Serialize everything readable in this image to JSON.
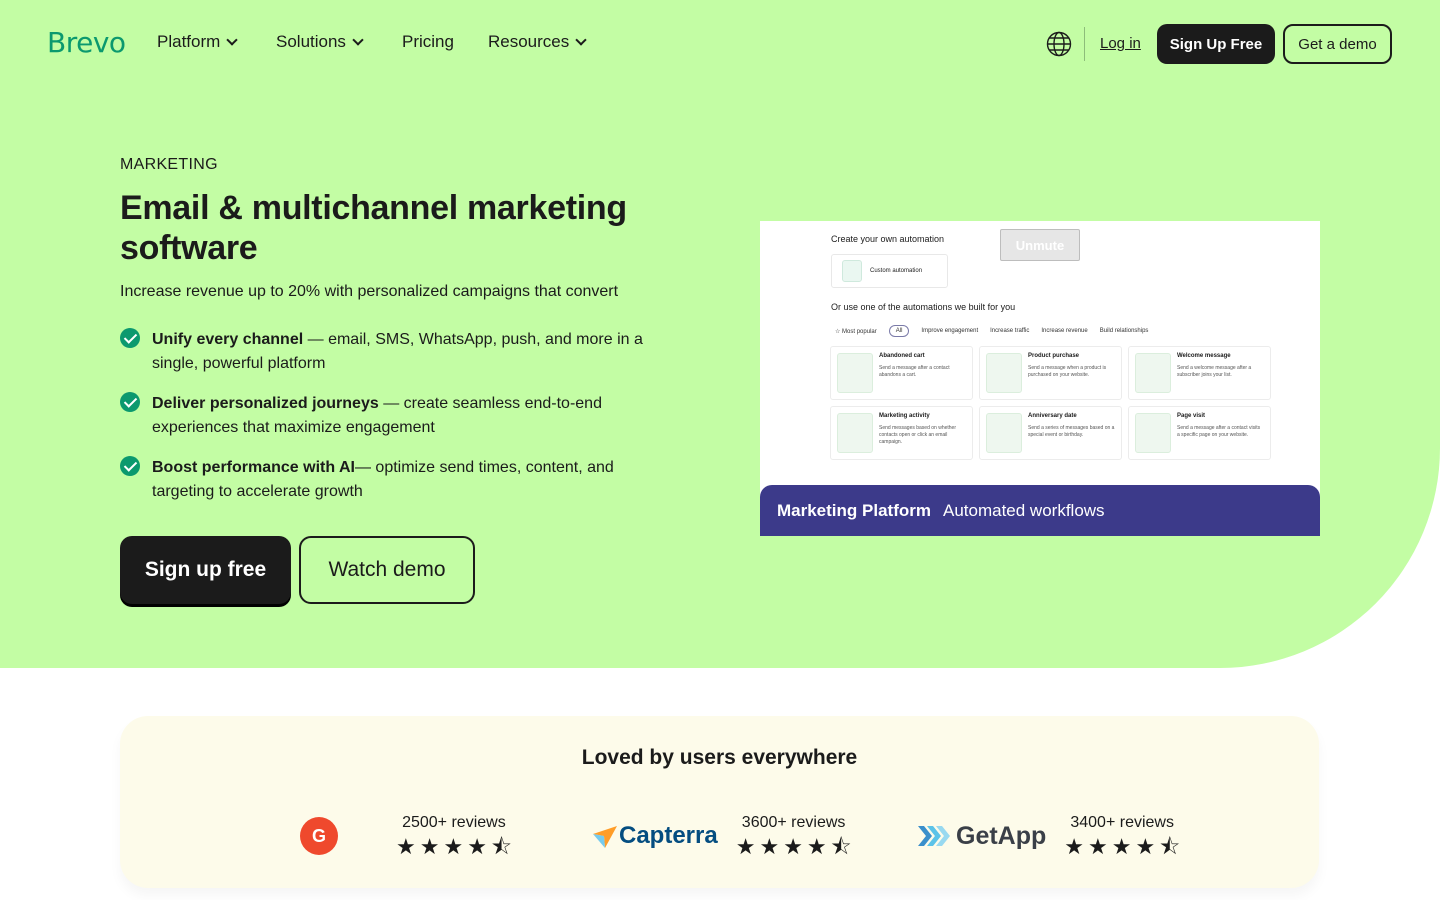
{
  "nav": {
    "logo": "Brevo",
    "items": [
      {
        "label": "Platform"
      },
      {
        "label": "Solutions"
      },
      {
        "label": "Pricing"
      },
      {
        "label": "Resources"
      }
    ],
    "login": "Log in",
    "signup": "Sign Up Free",
    "demo": "Get a demo"
  },
  "hero": {
    "eyebrow": "MARKETING",
    "title": "Email & multichannel marketing software",
    "subtitle": "Increase revenue up to 20% with personalized campaigns that convert",
    "features": [
      {
        "bold": "Unify every channel",
        "text": " — email, SMS, WhatsApp, push, and more in a single, powerful platform"
      },
      {
        "bold": "Deliver personalized journeys",
        "text": " — create seamless end-to-end experiences that maximize engagement"
      },
      {
        "bold": "Boost performance with AI",
        "text": "— optimize send times, content, and targeting to accelerate growth"
      }
    ],
    "cta_primary": "Sign up free",
    "cta_secondary": "Watch demo"
  },
  "video": {
    "heading": "Create your own automation",
    "unmute": "Unmute",
    "custom_card": "Custom automation",
    "subheading": "Or use one of the automations we built for you",
    "tabs": [
      "☆ Most popular",
      "All",
      "Improve engagement",
      "Increase traffic",
      "Increase revenue",
      "Build relationships"
    ],
    "cards": [
      {
        "title": "Abandoned cart",
        "desc": "Send a message after a contact abandons a cart."
      },
      {
        "title": "Product purchase",
        "desc": "Send a message when a product is purchased on your website."
      },
      {
        "title": "Welcome message",
        "desc": "Send a welcome message after a subscriber joins your list."
      },
      {
        "title": "Marketing activity",
        "desc": "Send messages based on whether contacts open or click an email campaign."
      },
      {
        "title": "Anniversary date",
        "desc": "Send a series of messages based on a special event or birthday."
      },
      {
        "title": "Page visit",
        "desc": "Send a message after a contact visits a specific page on your website."
      }
    ],
    "bar_bold": "Marketing Platform",
    "bar_text": "Automated workflows",
    "bar_color": "#3c3a8a"
  },
  "reviews": {
    "title": "Loved by users everywhere",
    "items": [
      {
        "brand": "G2",
        "count": "2500+ reviews",
        "rating": 4.5
      },
      {
        "brand": "Capterra",
        "count": "3600+ reviews",
        "rating": 4.5
      },
      {
        "brand": "GetApp",
        "count": "3400+ reviews",
        "rating": 4.5
      }
    ]
  },
  "colors": {
    "hero_bg": "#c3fda4",
    "brand_green": "#0b996e",
    "dark": "#1b1b1b",
    "reviews_bg": "#fdfbea"
  }
}
